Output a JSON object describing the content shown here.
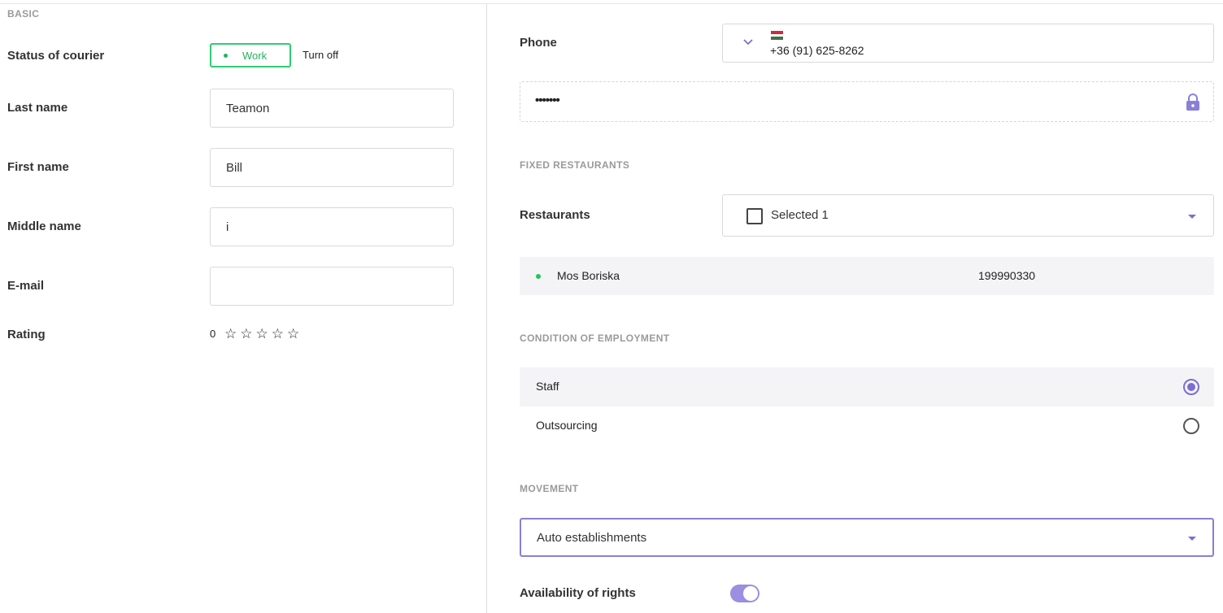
{
  "basic": {
    "section_title": "BASIC",
    "status": {
      "label": "Status of courier",
      "active_option": "Work",
      "inactive_option": "Turn off"
    },
    "last_name": {
      "label": "Last name",
      "value": "Teamon"
    },
    "first_name": {
      "label": "First name",
      "value": "Bill"
    },
    "middle_name": {
      "label": "Middle name",
      "value": "i"
    },
    "email": {
      "label": "E-mail",
      "value": ""
    },
    "rating": {
      "label": "Rating",
      "value": "0",
      "stars_filled": 0,
      "stars_total": 5,
      "star_glyph": "☆"
    }
  },
  "contact": {
    "phone_label": "Phone",
    "phone_value": "+36 (91) 625-8262",
    "country_flag": "hungary-flag",
    "password_value": "•••••••",
    "password_icon": "lock-icon"
  },
  "fixed_restaurants": {
    "section_title": "FIXED RESTAURANTS",
    "label": "Restaurants",
    "select_text": "Selected 1",
    "items": [
      {
        "name": "Mos Boriska",
        "id": "199990330"
      }
    ]
  },
  "employment": {
    "section_title": "CONDITION OF EMPLOYMENT",
    "options": [
      {
        "label": "Staff",
        "selected": true
      },
      {
        "label": "Outsourcing",
        "selected": false
      }
    ]
  },
  "movement": {
    "section_title": "MOVEMENT",
    "selected": "Auto establishments"
  },
  "rights": {
    "label": "Availability of rights",
    "enabled": true
  },
  "colors": {
    "accent": "#7a6fd0",
    "status_green": "#22b35e",
    "section_gray": "#9a9a9a"
  }
}
